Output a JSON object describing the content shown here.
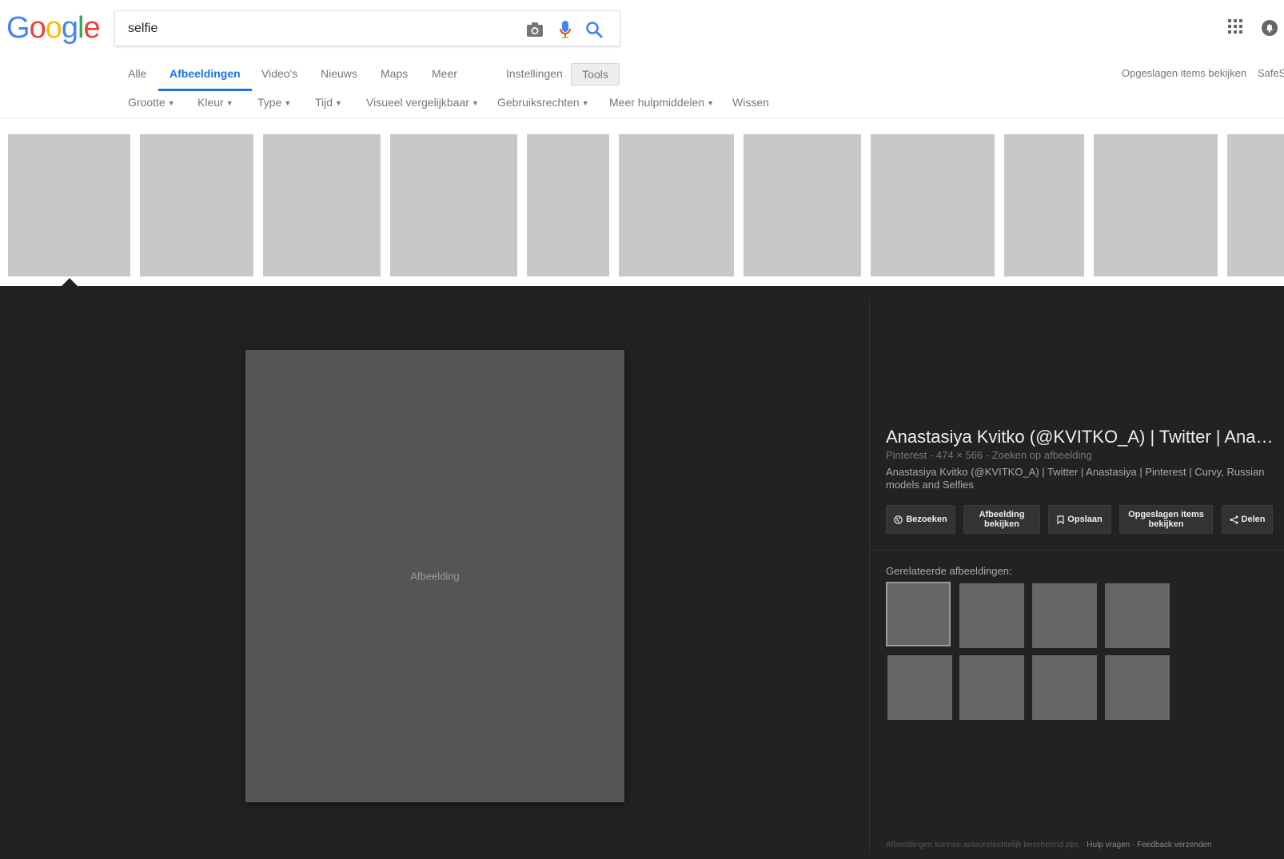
{
  "logo": {
    "letters": [
      "G",
      "o",
      "o",
      "g",
      "l",
      "e"
    ],
    "colors": [
      "#4285F4",
      "#EA4335",
      "#FBBC05",
      "#4285F4",
      "#34A853",
      "#EA4335"
    ]
  },
  "search": {
    "query": "selfie"
  },
  "tabs": [
    {
      "label": "Alle",
      "active": false
    },
    {
      "label": "Afbeeldingen",
      "active": true
    },
    {
      "label": "Video's",
      "active": false
    },
    {
      "label": "Nieuws",
      "active": false
    },
    {
      "label": "Maps",
      "active": false
    },
    {
      "label": "Meer",
      "active": false
    },
    {
      "label": "Instellingen",
      "active": false
    }
  ],
  "tools_label": "Tools",
  "right_links": {
    "saved": "Opgeslagen items bekijken",
    "safe": "SafeS"
  },
  "filters": [
    {
      "label": "Grootte",
      "caret": "▼"
    },
    {
      "label": "Kleur",
      "caret": "▼"
    },
    {
      "label": "Type",
      "caret": "▼"
    },
    {
      "label": "Tijd",
      "caret": "▼"
    },
    {
      "label": "Visueel vergelijkbaar",
      "caret": "▼"
    },
    {
      "label": "Gebruiksrechten",
      "caret": "▼"
    },
    {
      "label": "Meer hulpmiddelen",
      "caret": "▼"
    },
    {
      "label": "Wissen",
      "caret": ""
    }
  ],
  "strip_count": 11,
  "image_placeholder": "Afbeelding",
  "details": {
    "title": "Anastasiya Kvitko (@KVITKO_A) | Twitter | Anastasiya | Pinterest | Curvy, Russian models and Selfies",
    "source": "Pinterest",
    "sep": "-",
    "dimensions": "474 × 566",
    "search_by_image": "Zoeken op afbeelding",
    "description": "Anastasiya Kvitko (@KVITKO_A) | Twitter | Anastasiya | Pinterest | Curvy, Russian models and Selfies"
  },
  "buttons": {
    "visit": "Bezoeken",
    "view_image": "Afbeelding bekijken",
    "save": "Opslaan",
    "view_saved": "Opgeslagen items bekijken",
    "share": "Delen"
  },
  "related": {
    "label": "Gerelateerde afbeeldingen:",
    "count": 8
  },
  "footer": {
    "copyright": "Afbeeldingen kunnen auteursrechtelijk beschermd zijn.",
    "sep": "-",
    "help": "Hulp vragen",
    "feedback": "Feedback verzenden"
  },
  "colors": {
    "accent": "#1a73e8",
    "panel_bg": "#222222"
  }
}
